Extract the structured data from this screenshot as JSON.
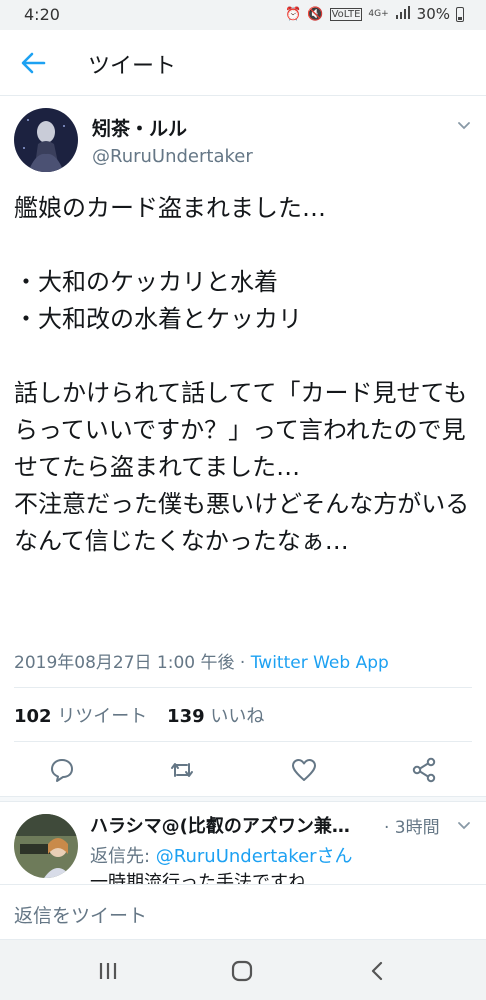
{
  "status_bar": {
    "time": "4:20",
    "icons": [
      "alarm-icon",
      "mute-icon",
      "volte-icon",
      "4g-icon",
      "signal-icon",
      "battery-icon"
    ],
    "network": "4G+",
    "battery": "30%"
  },
  "header": {
    "title": "ツイート",
    "back_icon": "arrow-left-icon"
  },
  "tweet": {
    "display_name": "矧茶・ルル",
    "username": "@RuruUndertaker",
    "text": "艦娘のカード盗まれました…\n\n・大和のケッカリと水着\n・大和改の水着とケッカリ\n\n話しかけられて話してて「カード見せてもらっていいですか？」って言われたので見せてたら盗まれてました…\n不注意だった僕も悪いけどそんな方がいるなんて信じたくなかったなぁ…",
    "timestamp": "2019年08月27日 1:00 午後",
    "separator": " · ",
    "source": "Twitter Web App",
    "retweet_count": "102",
    "retweet_label": "リツイート",
    "like_count": "139",
    "like_label": "いいね",
    "actions": [
      "reply-icon",
      "retweet-icon",
      "like-icon",
      "share-icon"
    ]
  },
  "reply": {
    "name": "ハラシマ@(比叡のアズワン兼…",
    "time": "· 3時間",
    "reply_to_label": "返信先: ",
    "reply_to_handle": "@RuruUndertaker",
    "reply_to_suffix": "さん",
    "text": "一時期流行った手法ですね"
  },
  "compose": {
    "placeholder": "返信をツイート"
  },
  "colors": {
    "accent": "#1da1f2",
    "text": "#14171a",
    "secondary": "#657786",
    "divider": "#e6ecf0"
  }
}
